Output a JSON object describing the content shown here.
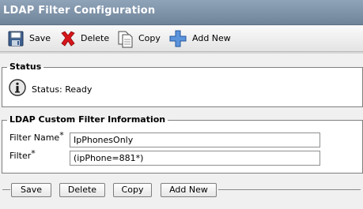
{
  "window": {
    "title": "LDAP Filter Configuration"
  },
  "toolbar": {
    "save": {
      "label": "Save",
      "icon": "floppy-disk-icon"
    },
    "delete": {
      "label": "Delete",
      "icon": "red-x-icon"
    },
    "copy": {
      "label": "Copy",
      "icon": "copy-pages-icon"
    },
    "add_new": {
      "label": "Add New",
      "icon": "blue-plus-icon"
    }
  },
  "status": {
    "legend": "Status",
    "icon": "info-icon",
    "text": "Status: Ready"
  },
  "filter_info": {
    "legend": "LDAP Custom Filter Information",
    "filter_name_label": "Filter Name",
    "filter_name_value": "IpPhonesOnly",
    "filter_label": "Filter",
    "filter_value": "(ipPhone=881*)",
    "required_marker": "*"
  },
  "bottom_buttons": {
    "save": "Save",
    "delete": "Delete",
    "copy": "Copy",
    "add_new": "Add New"
  },
  "colors": {
    "titlebar": "#7b8fa5",
    "delete_red": "#d8151b",
    "add_blue": "#3f7fd0"
  }
}
